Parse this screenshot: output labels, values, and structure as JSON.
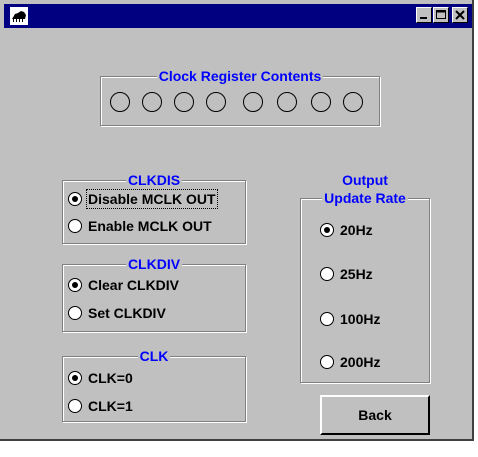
{
  "window": {
    "title": ""
  },
  "clock_register": {
    "label": "Clock Register Contents",
    "led_count": 8
  },
  "clkdis": {
    "label": "CLKDIS",
    "options": [
      {
        "label": "Disable MCLK OUT",
        "checked": true
      },
      {
        "label": "Enable MCLK OUT",
        "checked": false
      }
    ]
  },
  "clkdiv": {
    "label": "CLKDIV",
    "options": [
      {
        "label": "Clear CLKDIV",
        "checked": true
      },
      {
        "label": "Set CLKDIV",
        "checked": false
      }
    ]
  },
  "clk": {
    "label": "CLK",
    "options": [
      {
        "label": "CLK=0",
        "checked": true
      },
      {
        "label": "CLK=1",
        "checked": false
      }
    ]
  },
  "output_rate": {
    "label_line1": "Output",
    "label_line2": "Update Rate",
    "options": [
      {
        "label": "20Hz",
        "checked": true
      },
      {
        "label": "25Hz",
        "checked": false
      },
      {
        "label": "100Hz",
        "checked": false
      },
      {
        "label": "200Hz",
        "checked": false
      }
    ]
  },
  "buttons": {
    "back": "Back"
  },
  "colors": {
    "titlebar": "#000080",
    "face": "#c0c0c0",
    "group_label": "#0000ff"
  },
  "icons": [
    "app-icon",
    "minimize-icon",
    "maximize-icon",
    "close-icon"
  ]
}
